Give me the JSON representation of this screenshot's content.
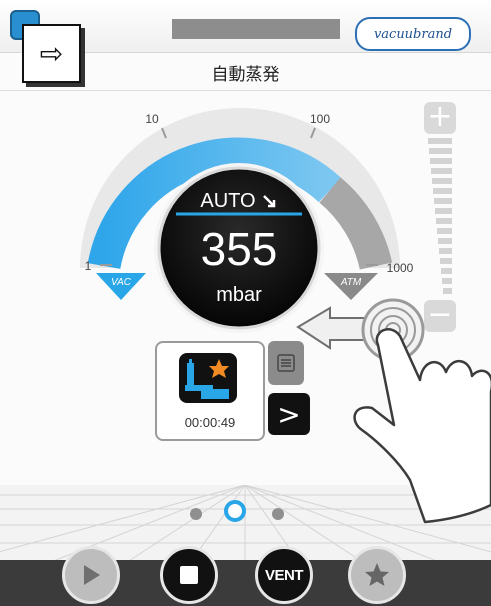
{
  "header": {
    "brand": "vacuubrand",
    "title": "自動蒸発"
  },
  "gauge": {
    "scale_labels": [
      "1",
      "10",
      "100",
      "1000"
    ],
    "vac_label": "VAC",
    "atm_label": "ATM",
    "mode": "AUTO",
    "value": "355",
    "unit": "mbar"
  },
  "method": {
    "time": "00:00:49"
  },
  "pager": {
    "pages": 3,
    "active": 2
  },
  "controls": {
    "vent_label": "VENT"
  },
  "colors": {
    "accent": "#29a6e8",
    "gauge_dark": "#111111",
    "inactive": "#bdbdbd"
  },
  "icons": {
    "nav": "arrow-right-icon",
    "play": "play-icon",
    "stop": "stop-icon",
    "favorite": "star-icon",
    "list": "list-icon",
    "next": "chevron-right-icon"
  }
}
